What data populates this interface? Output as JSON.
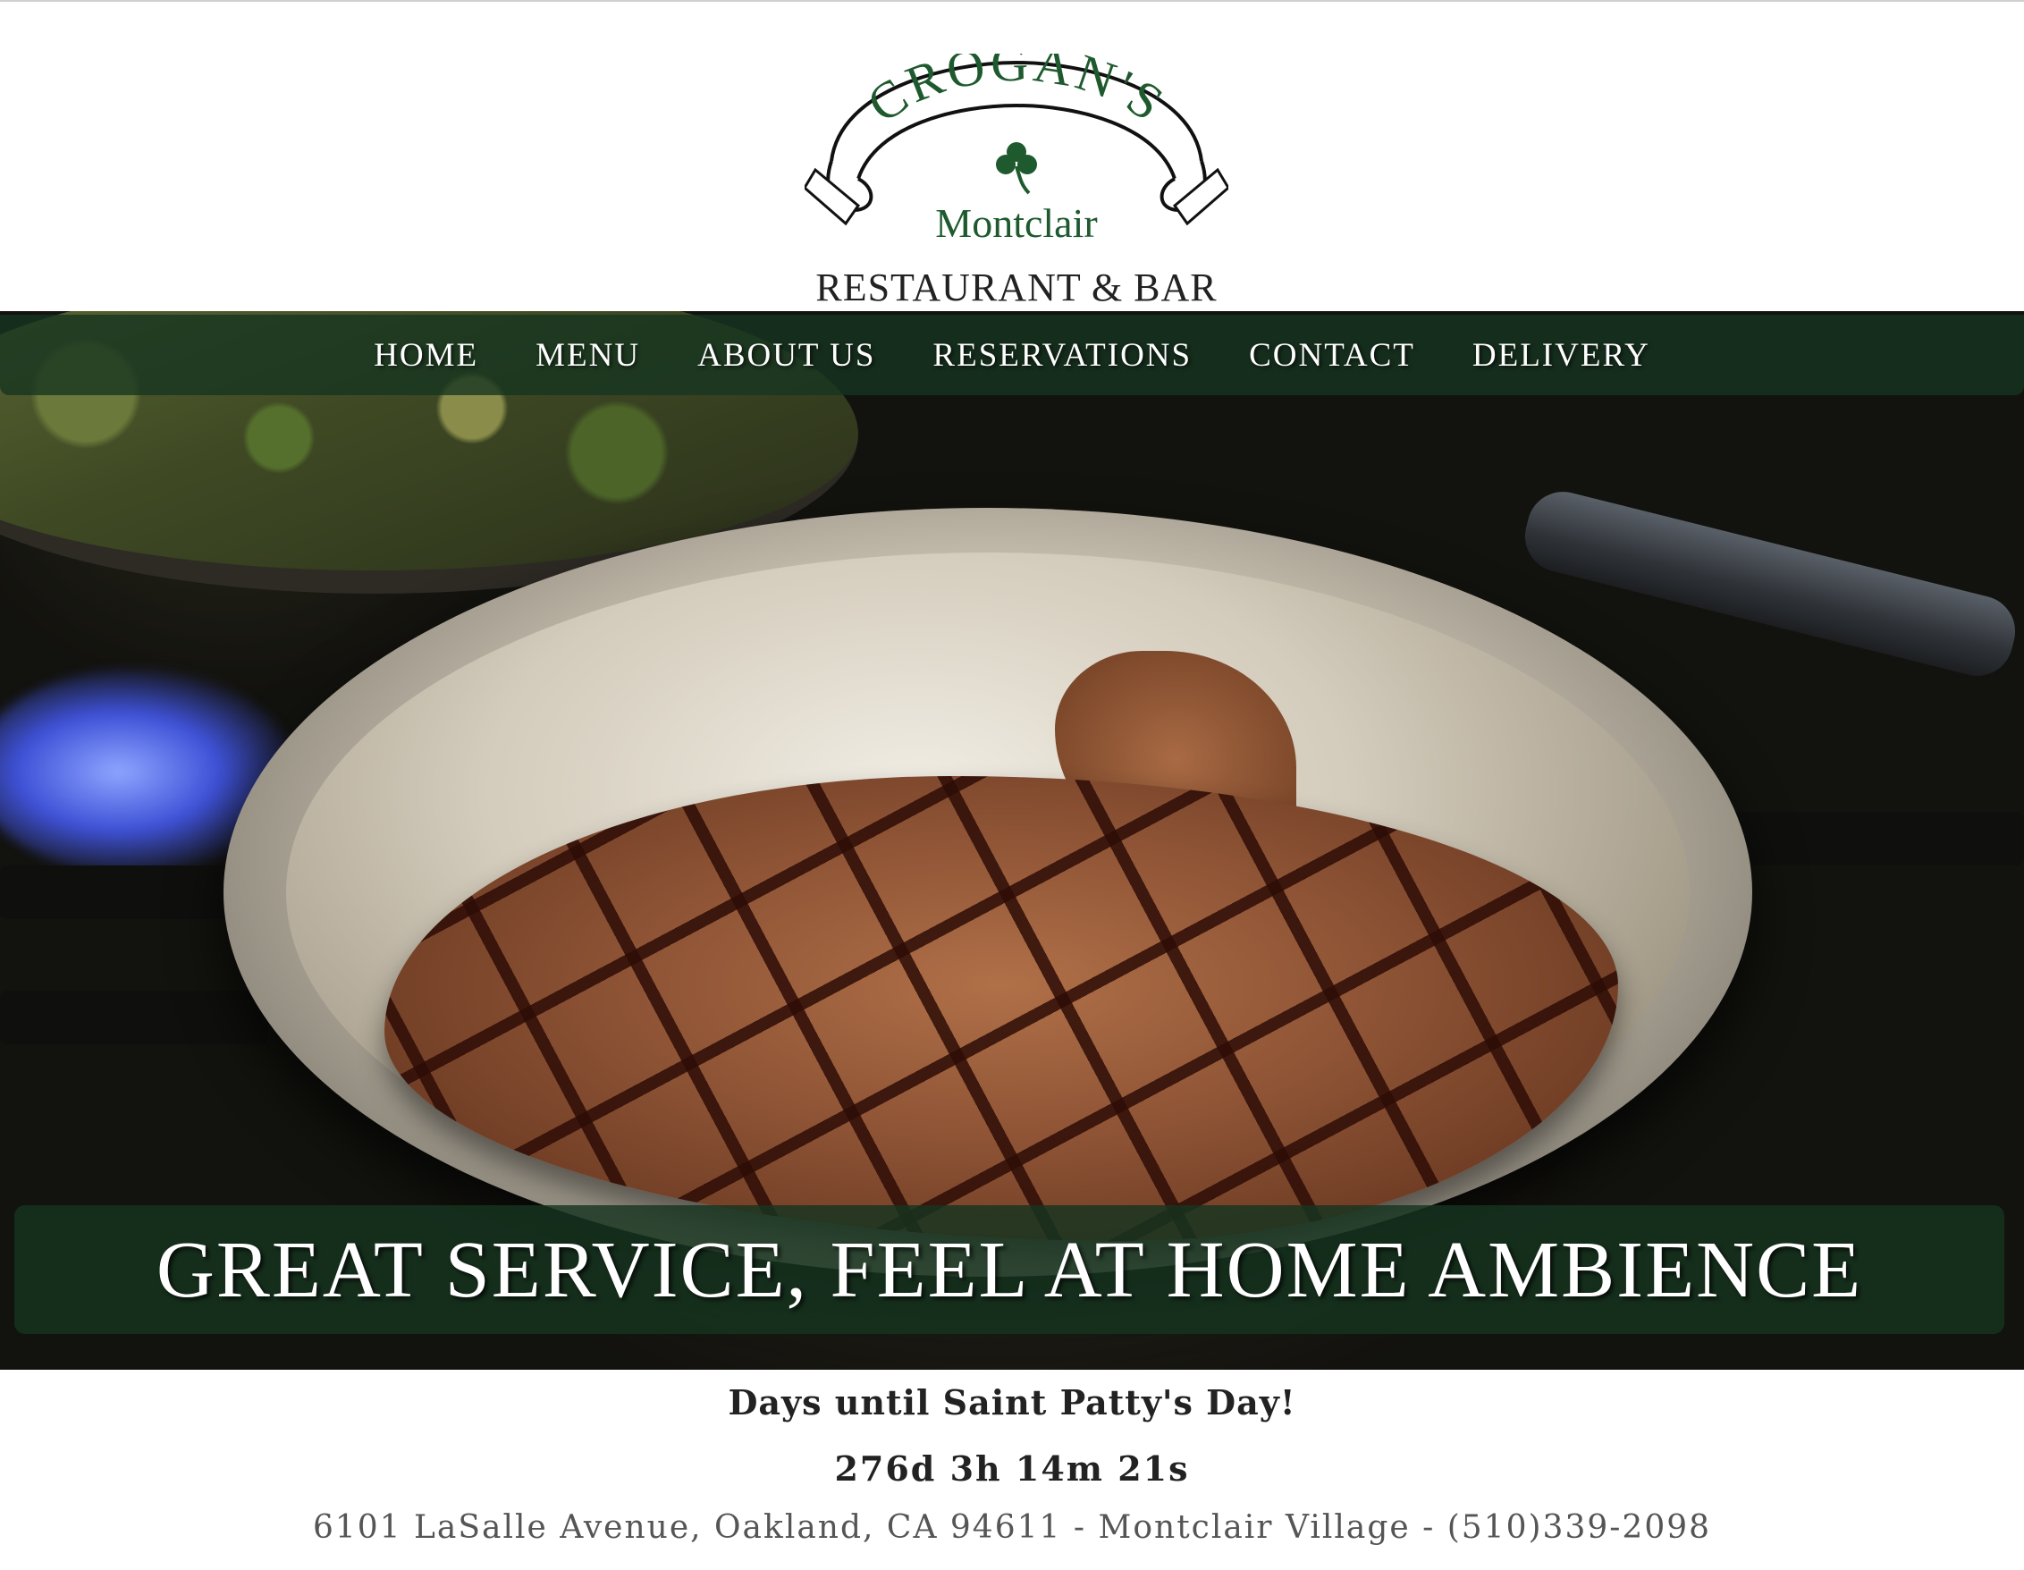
{
  "logo": {
    "arch_text": "CROGAN'S",
    "location_text": "Montclair",
    "subtitle": "RESTAURANT & BAR",
    "colors": {
      "green": "#1e5a2e",
      "outline": "#111111"
    }
  },
  "nav": {
    "items": [
      {
        "label": "HOME"
      },
      {
        "label": "MENU"
      },
      {
        "label": "ABOUT US"
      },
      {
        "label": "RESERVATIONS"
      },
      {
        "label": "CONTACT"
      },
      {
        "label": "DELIVERY"
      }
    ],
    "background": "#163420"
  },
  "hero": {
    "banner_text": "GREAT SERVICE, FEEL AT HOME AMBIENCE"
  },
  "countdown": {
    "label": "Days until Saint Patty's Day!",
    "value": "276d 3h 14m 21s"
  },
  "footer": {
    "address": "6101 LaSalle Avenue, Oakland, CA 94611 - Montclair Village - (510)339-2098"
  }
}
